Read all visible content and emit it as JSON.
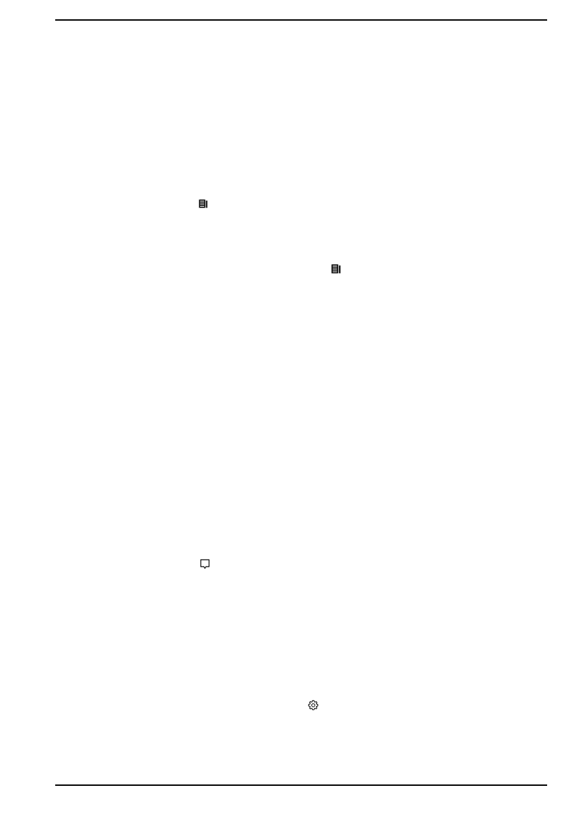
{
  "page": {
    "background": "#ffffff",
    "ink": "#000000"
  },
  "icons": {
    "first": "news-icon",
    "second": "news-icon",
    "third": "action-center-icon",
    "fourth": "settings-gear-icon"
  }
}
